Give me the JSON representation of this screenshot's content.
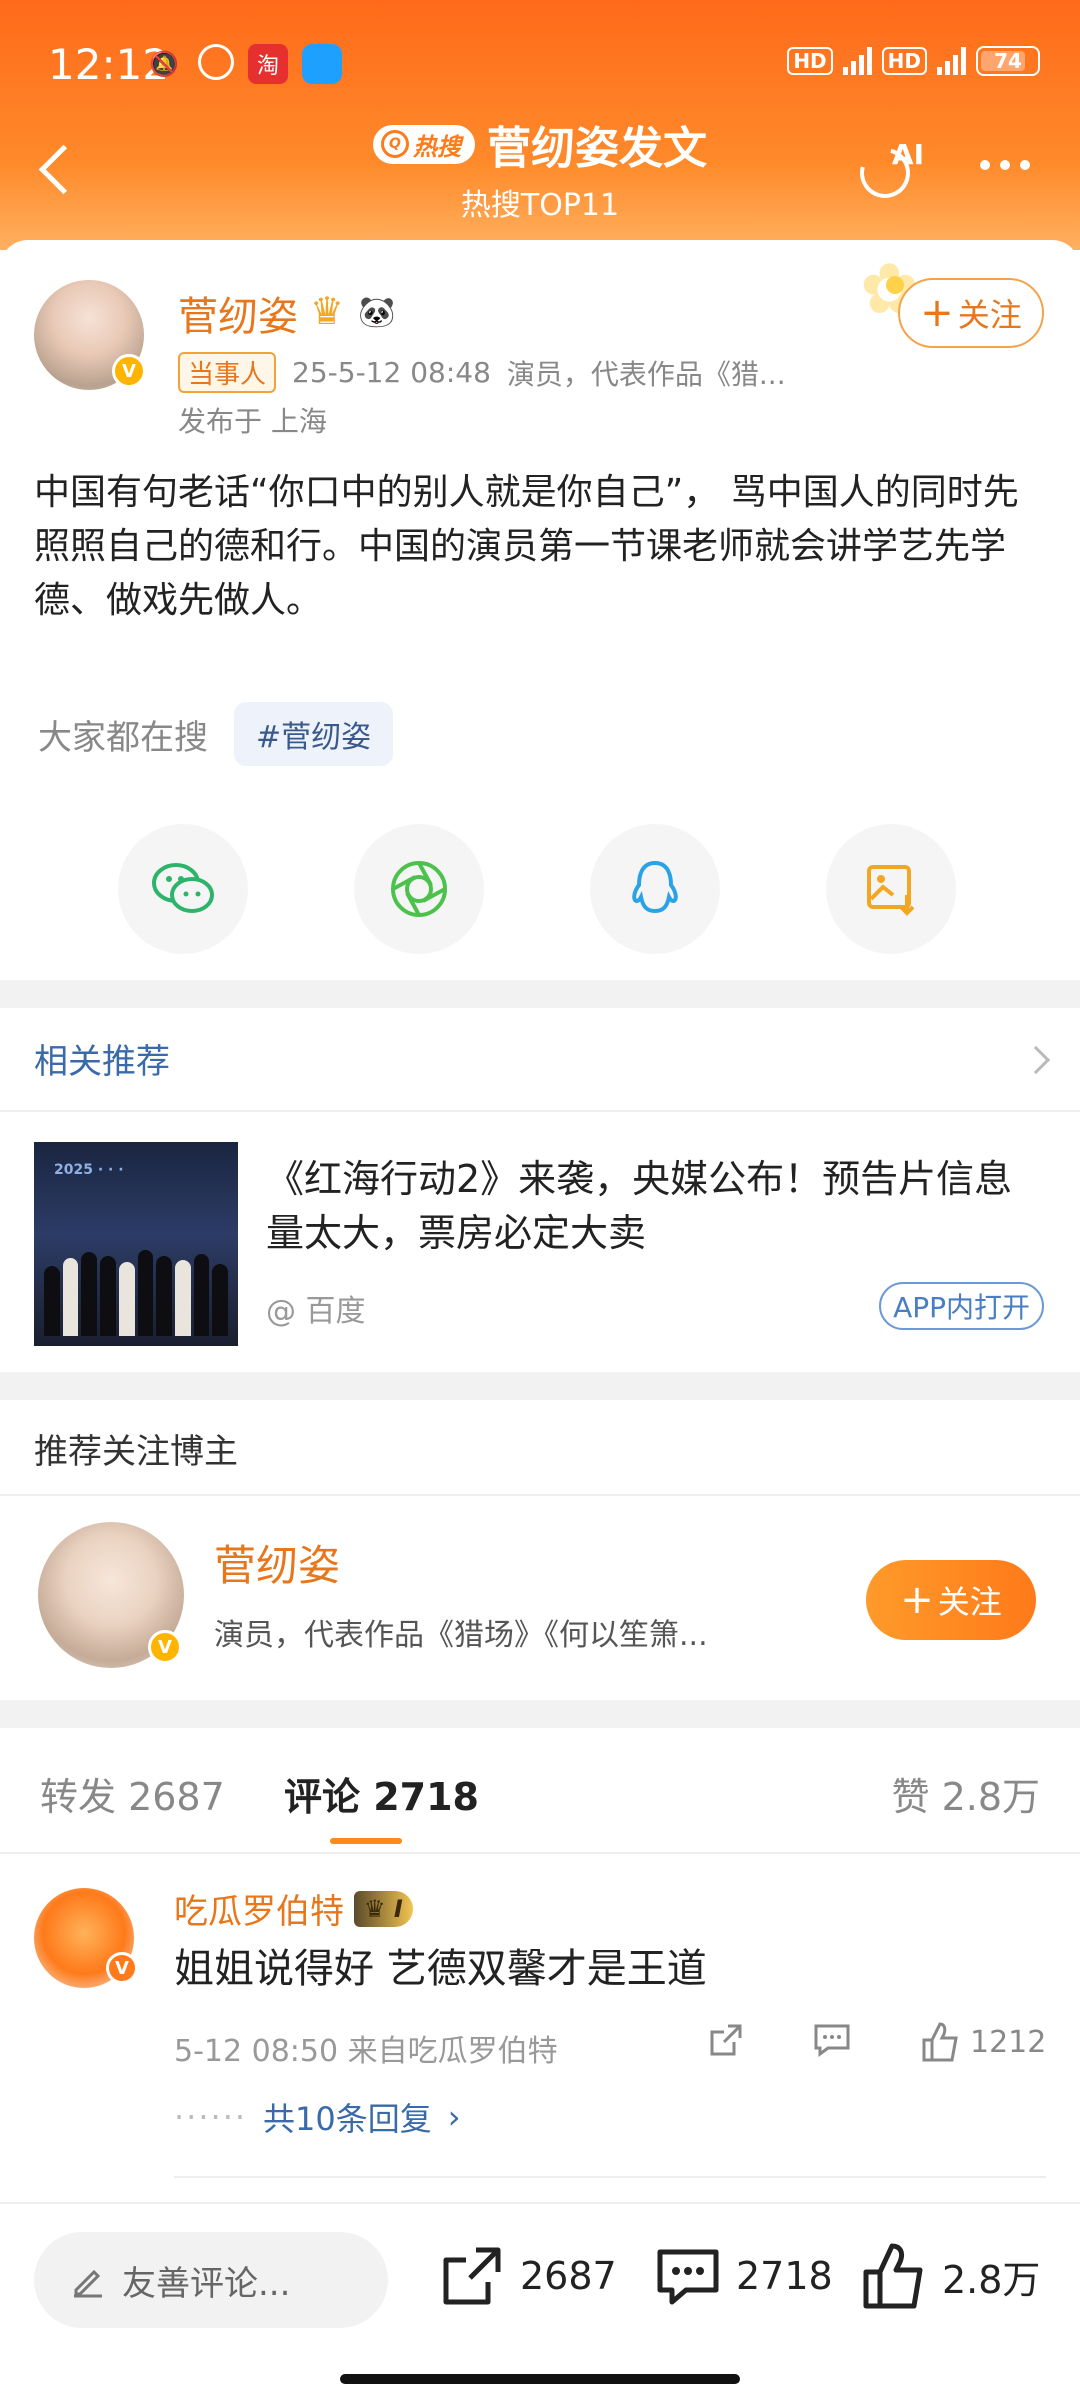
{
  "status_bar": {
    "time": "12:12",
    "battery": "74"
  },
  "nav": {
    "badge": "热搜",
    "title": "菅纫姿发文",
    "subtitle": "热搜TOP11",
    "ai_label": "AI"
  },
  "post": {
    "author": "菅纫姿",
    "role_tag": "当事人",
    "date": "25-5-12 08:48",
    "bio": "演员，代表作品《猎...",
    "location": "发布于 上海",
    "follow_label": "关注",
    "text": "中国有句老话“你口中的别人就是你自己”， 骂中国人的同时先照照自己的德和行。中国的演员第一节课老师就会讲学艺先学德、做戏先做人。",
    "search_label": "大家都在搜",
    "hashtag": "#菅纫姿"
  },
  "related": {
    "heading": "相关推荐",
    "title": "《红海行动2》来袭，央媒公布！预告片信息量太大，票房必定大卖",
    "source": "@ 百度",
    "open_label": "APP内打开"
  },
  "recommend": {
    "heading": "推荐关注博主",
    "name": "菅纫姿",
    "desc": "演员，代表作品《猎场》《何以笙箫...",
    "follow_label": "关注"
  },
  "tabs": {
    "repost": "转发 2687",
    "comments": "评论 2718",
    "likes": "赞 2.8万"
  },
  "comment": {
    "name": "吃瓜罗伯特",
    "vip": "I",
    "text": "姐姐说得好 艺德双馨才是王道",
    "meta": "5-12 08:50 来自吃瓜罗伯特",
    "likes": "1212",
    "replies": "共10条回复",
    "dots": "······"
  },
  "bottom_bar": {
    "input_placeholder": "友善评论...",
    "reposts": "2687",
    "comments": "2718",
    "likes": "2.8万"
  },
  "colors": {
    "accent": "#ff7a1a",
    "link": "#3a6aa8",
    "wechat": "#2db46b",
    "moments": "#4cc24c",
    "qq": "#2aa2e8",
    "save": "#f4a623"
  }
}
